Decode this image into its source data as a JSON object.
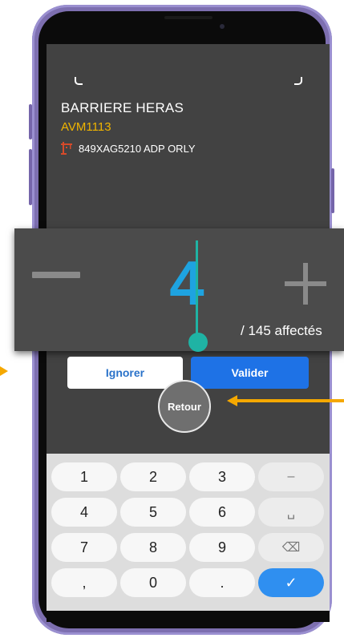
{
  "screen": {
    "title": "BARRIERE HERAS",
    "code": "AVM1113",
    "vehicle": {
      "icon": "crane-icon",
      "text": "849XAG5210 ADP ORLY"
    }
  },
  "counter": {
    "value": "4",
    "assigned": "/ 145 affectés",
    "minus_icon": "minus-icon",
    "plus_icon": "plus-icon"
  },
  "actions": {
    "ignore": "Ignorer",
    "validate": "Valider",
    "back": "Retour"
  },
  "keyboard": {
    "keys": [
      "1",
      "2",
      "3",
      "–",
      "4",
      "5",
      "6",
      "␣",
      "7",
      "8",
      "9",
      "⌫",
      ",",
      "0",
      ".",
      "✓"
    ]
  },
  "colors": {
    "accent": "#1e72e6",
    "count": "#1ea3e0",
    "code": "#f0b400",
    "annotation": "#f5a800",
    "phone_frame": "#7d6fb0"
  }
}
